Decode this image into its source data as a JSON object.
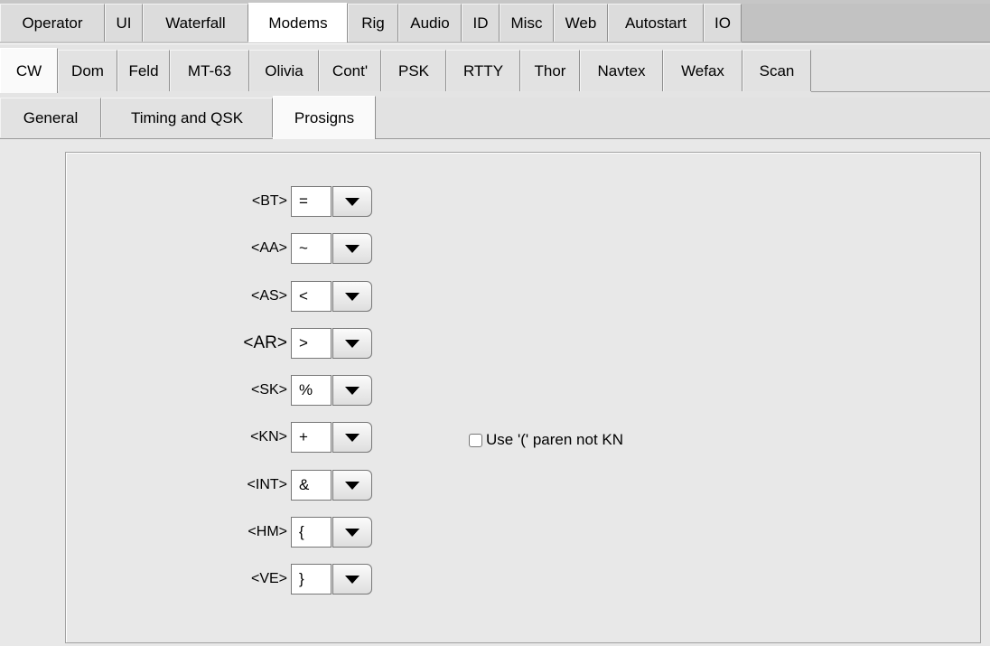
{
  "tabs_main": [
    "Operator",
    "UI",
    "Waterfall",
    "Modems",
    "Rig",
    "Audio",
    "ID",
    "Misc",
    "Web",
    "Autostart",
    "IO"
  ],
  "tabs_main_active": "Modems",
  "tabs_modem": [
    "CW",
    "Dom",
    "Feld",
    "MT-63",
    "Olivia",
    "Cont'",
    "PSK",
    "RTTY",
    "Thor",
    "Navtex",
    "Wefax",
    "Scan"
  ],
  "tabs_modem_active": "CW",
  "tabs_cw": [
    "General",
    "Timing and QSK",
    "Prosigns"
  ],
  "tabs_cw_active": "Prosigns",
  "prosigns": [
    {
      "label": "<BT>",
      "value": "="
    },
    {
      "label": "<AA>",
      "value": "~"
    },
    {
      "label": "<AS>",
      "value": "<"
    },
    {
      "label": "<AR>",
      "value": ">"
    },
    {
      "label": "<SK>",
      "value": "%"
    },
    {
      "label": "<KN>",
      "value": "+"
    },
    {
      "label": "<INT>",
      "value": "&"
    },
    {
      "label": "<HM>",
      "value": "{"
    },
    {
      "label": "<VE>",
      "value": "}"
    }
  ],
  "kn_paren_checkbox": {
    "label": "Use '(' paren not KN",
    "checked": false
  },
  "icons": {
    "dropdown": "chevron-down-icon"
  }
}
